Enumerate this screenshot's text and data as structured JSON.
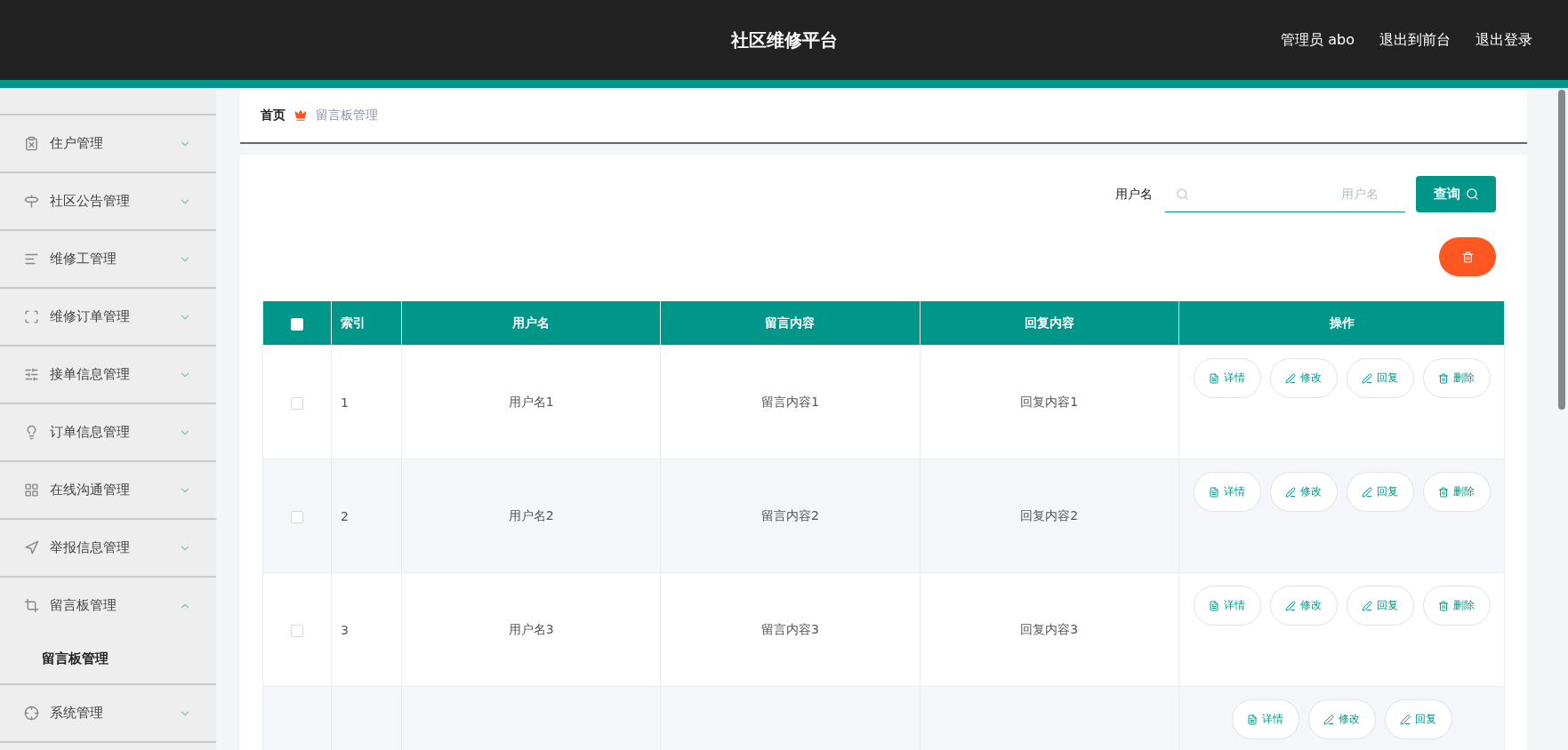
{
  "header": {
    "title": "社区维修平台",
    "links": [
      "管理员 abo",
      "退出到前台",
      "退出登录"
    ]
  },
  "sidebar": {
    "items": [
      {
        "label": "住户管理",
        "expanded": false
      },
      {
        "label": "社区公告管理",
        "expanded": false
      },
      {
        "label": "维修工管理",
        "expanded": false
      },
      {
        "label": "维修订单管理",
        "expanded": false
      },
      {
        "label": "接单信息管理",
        "expanded": false
      },
      {
        "label": "订单信息管理",
        "expanded": false
      },
      {
        "label": "在线沟通管理",
        "expanded": false
      },
      {
        "label": "举报信息管理",
        "expanded": false
      },
      {
        "label": "留言板管理",
        "expanded": true,
        "children": [
          {
            "label": "留言板管理",
            "selected": true
          }
        ]
      },
      {
        "label": "系统管理",
        "expanded": false
      }
    ]
  },
  "breadcrumb": {
    "home": "首页",
    "current": "留言板管理"
  },
  "search": {
    "label": "用户名",
    "placeholder": "用户名",
    "button": "查询"
  },
  "table": {
    "all_checked": false,
    "columns": [
      "索引",
      "用户名",
      "留言内容",
      "回复内容",
      "操作"
    ],
    "rows": [
      {
        "checked": false,
        "index": "1",
        "username": "用户名1",
        "message": "留言内容1",
        "reply": "回复内容1",
        "actions": [
          "详情",
          "修改",
          "回复",
          "删除"
        ]
      },
      {
        "checked": false,
        "index": "2",
        "username": "用户名2",
        "message": "留言内容2",
        "reply": "回复内容2",
        "actions": [
          "详情",
          "修改",
          "回复",
          "删除"
        ]
      },
      {
        "checked": false,
        "index": "3",
        "username": "用户名3",
        "message": "留言内容3",
        "reply": "回复内容3",
        "actions": [
          "详情",
          "修改",
          "回复",
          "删除"
        ]
      },
      {
        "actions": [
          "详情",
          "修改",
          "回复"
        ]
      }
    ]
  }
}
